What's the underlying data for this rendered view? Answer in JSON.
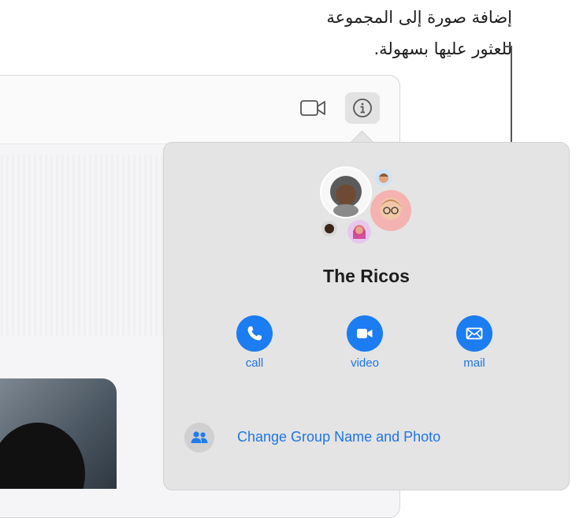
{
  "callout": {
    "line1": "إضافة صورة إلى المجموعة",
    "line2": "للعثور عليها بسهولة."
  },
  "toolbar": {
    "video_icon": "video-camera-icon",
    "info_icon": "info-icon"
  },
  "details": {
    "group_name": "The Ricos",
    "actions": [
      {
        "label": "call",
        "icon": "phone-icon"
      },
      {
        "label": "video",
        "icon": "video-icon"
      },
      {
        "label": "mail",
        "icon": "envelope-icon"
      }
    ],
    "change_group_label": "Change Group Name and Photo",
    "change_group_icon": "people-icon"
  },
  "colors": {
    "accent": "#1c7cf2",
    "link": "#1f76e3",
    "panel_bg": "#e4e4e4"
  }
}
